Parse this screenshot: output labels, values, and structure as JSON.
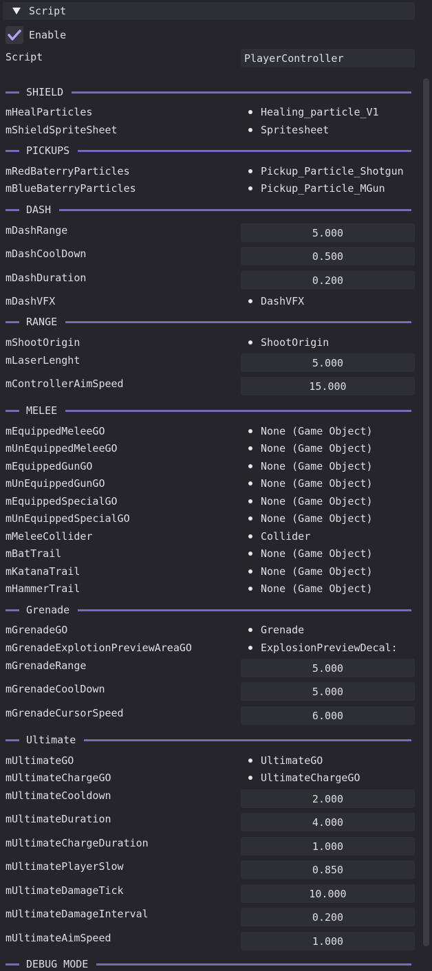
{
  "component": {
    "title": "Script",
    "enable_label": "Enable",
    "script_label": "Script",
    "script_value": "PlayerController"
  },
  "sections": {
    "shield": "SHIELD",
    "pickups": "PICKUPS",
    "dash": "DASH",
    "range": "RANGE",
    "melee": "MELEE",
    "grenade": "Grenade",
    "ultimate": "Ultimate",
    "debug": "DEBUG MODE"
  },
  "fields": {
    "mHealParticles": {
      "label": "mHealParticles",
      "value": "Healing_particle_V1"
    },
    "mShieldSpriteSheet": {
      "label": "mShieldSpriteSheet",
      "value": "Spritesheet"
    },
    "mRedBaterryParticles": {
      "label": "mRedBaterryParticles",
      "value": "Pickup_Particle_Shotgun"
    },
    "mBlueBaterryParticles": {
      "label": "mBlueBaterryParticles",
      "value": "Pickup_Particle_MGun"
    },
    "mDashRange": {
      "label": "mDashRange",
      "value": "5.000"
    },
    "mDashCoolDown": {
      "label": "mDashCoolDown",
      "value": "0.500"
    },
    "mDashDuration": {
      "label": "mDashDuration",
      "value": "0.200"
    },
    "mDashVFX": {
      "label": "mDashVFX",
      "value": "DashVFX"
    },
    "mShootOrigin": {
      "label": "mShootOrigin",
      "value": "ShootOrigin"
    },
    "mLaserLenght": {
      "label": "mLaserLenght",
      "value": "5.000"
    },
    "mControllerAimSpeed": {
      "label": "mControllerAimSpeed",
      "value": "15.000"
    },
    "mEquippedMeleeGO": {
      "label": "mEquippedMeleeGO",
      "value": "None (Game Object)"
    },
    "mUnEquippedMeleeGO": {
      "label": "mUnEquippedMeleeGO",
      "value": "None (Game Object)"
    },
    "mEquippedGunGO": {
      "label": "mEquippedGunGO",
      "value": "None (Game Object)"
    },
    "mUnEquippedGunGO": {
      "label": "mUnEquippedGunGO",
      "value": "None (Game Object)"
    },
    "mEquippedSpecialGO": {
      "label": "mEquippedSpecialGO",
      "value": "None (Game Object)"
    },
    "mUnEquippedSpecialGO": {
      "label": "mUnEquippedSpecialGO",
      "value": "None (Game Object)"
    },
    "mMeleeCollider": {
      "label": "mMeleeCollider",
      "value": "Collider"
    },
    "mBatTrail": {
      "label": "mBatTrail",
      "value": "None (Game Object)"
    },
    "mKatanaTrail": {
      "label": "mKatanaTrail",
      "value": "None (Game Object)"
    },
    "mHammerTrail": {
      "label": "mHammerTrail",
      "value": "None (Game Object)"
    },
    "mGrenadeGO": {
      "label": "mGrenadeGO",
      "value": "Grenade"
    },
    "mGrenadeExplotionPreviewAreaGO": {
      "label": "mGrenadeExplotionPreviewAreaGO",
      "value": "ExplosionPreviewDecal:"
    },
    "mGrenadeRange": {
      "label": "mGrenadeRange",
      "value": "5.000"
    },
    "mGrenadeCoolDown": {
      "label": "mGrenadeCoolDown",
      "value": "5.000"
    },
    "mGrenadeCursorSpeed": {
      "label": "mGrenadeCursorSpeed",
      "value": "6.000"
    },
    "mUltimateGO": {
      "label": "mUltimateGO",
      "value": "UltimateGO"
    },
    "mUltimateChargeGO": {
      "label": "mUltimateChargeGO",
      "value": "UltimateChargeGO"
    },
    "mUltimateCooldown": {
      "label": "mUltimateCooldown",
      "value": "2.000"
    },
    "mUltimateDuration": {
      "label": "mUltimateDuration",
      "value": "4.000"
    },
    "mUltimateChargeDuration": {
      "label": "mUltimateChargeDuration",
      "value": "1.000"
    },
    "mUltimatePlayerSlow": {
      "label": "mUltimatePlayerSlow",
      "value": "0.850"
    },
    "mUltimateDamageTick": {
      "label": "mUltimateDamageTick",
      "value": "10.000"
    },
    "mUltimateDamageInterval": {
      "label": "mUltimateDamageInterval",
      "value": "0.200"
    },
    "mUltimateAimSpeed": {
      "label": "mUltimateAimSpeed",
      "value": "1.000"
    }
  },
  "colors": {
    "background": "#25252b",
    "field": "#2e2e35",
    "accent": "#7a6ab8",
    "text": "#dedee4"
  }
}
